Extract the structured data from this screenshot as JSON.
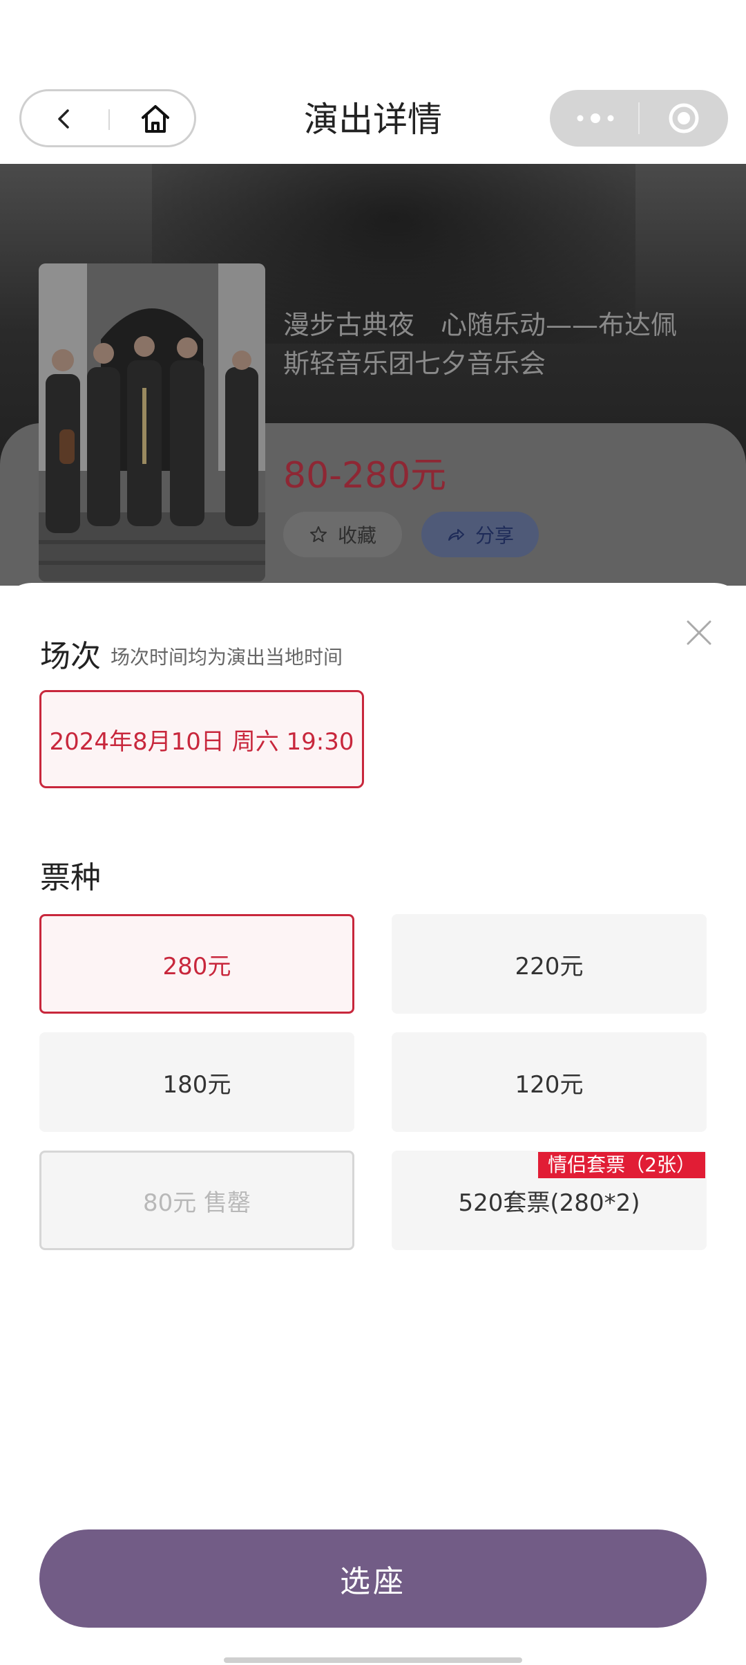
{
  "nav": {
    "title": "演出详情"
  },
  "show": {
    "title": "漫步古典夜　心随乐动——布达佩斯轻音乐团七夕音乐会",
    "price_range": "80-280元",
    "favorite_label": "收藏",
    "share_label": "分享"
  },
  "sheet": {
    "session_title": "场次",
    "session_note": "场次时间均为演出当地时间",
    "sessions": [
      {
        "label": "2024年8月10日 周六 19:30",
        "selected": true
      }
    ],
    "ticket_title": "票种",
    "tickets": [
      {
        "label": "280元",
        "state": "selected"
      },
      {
        "label": "220元",
        "state": "normal"
      },
      {
        "label": "180元",
        "state": "normal"
      },
      {
        "label": "120元",
        "state": "normal"
      },
      {
        "label": "80元 售罄",
        "state": "soldout"
      },
      {
        "label": "520套票(280*2)",
        "state": "normal",
        "tag": "情侣套票（2张）"
      }
    ],
    "cta_label": "选座"
  },
  "colors": {
    "accent_red": "#c8273c",
    "tag_red": "#e11d35",
    "cta_purple": "#725c86"
  },
  "icons": [
    "back-icon",
    "home-icon",
    "more-icon",
    "target-icon",
    "star-icon",
    "share-icon",
    "close-icon"
  ]
}
